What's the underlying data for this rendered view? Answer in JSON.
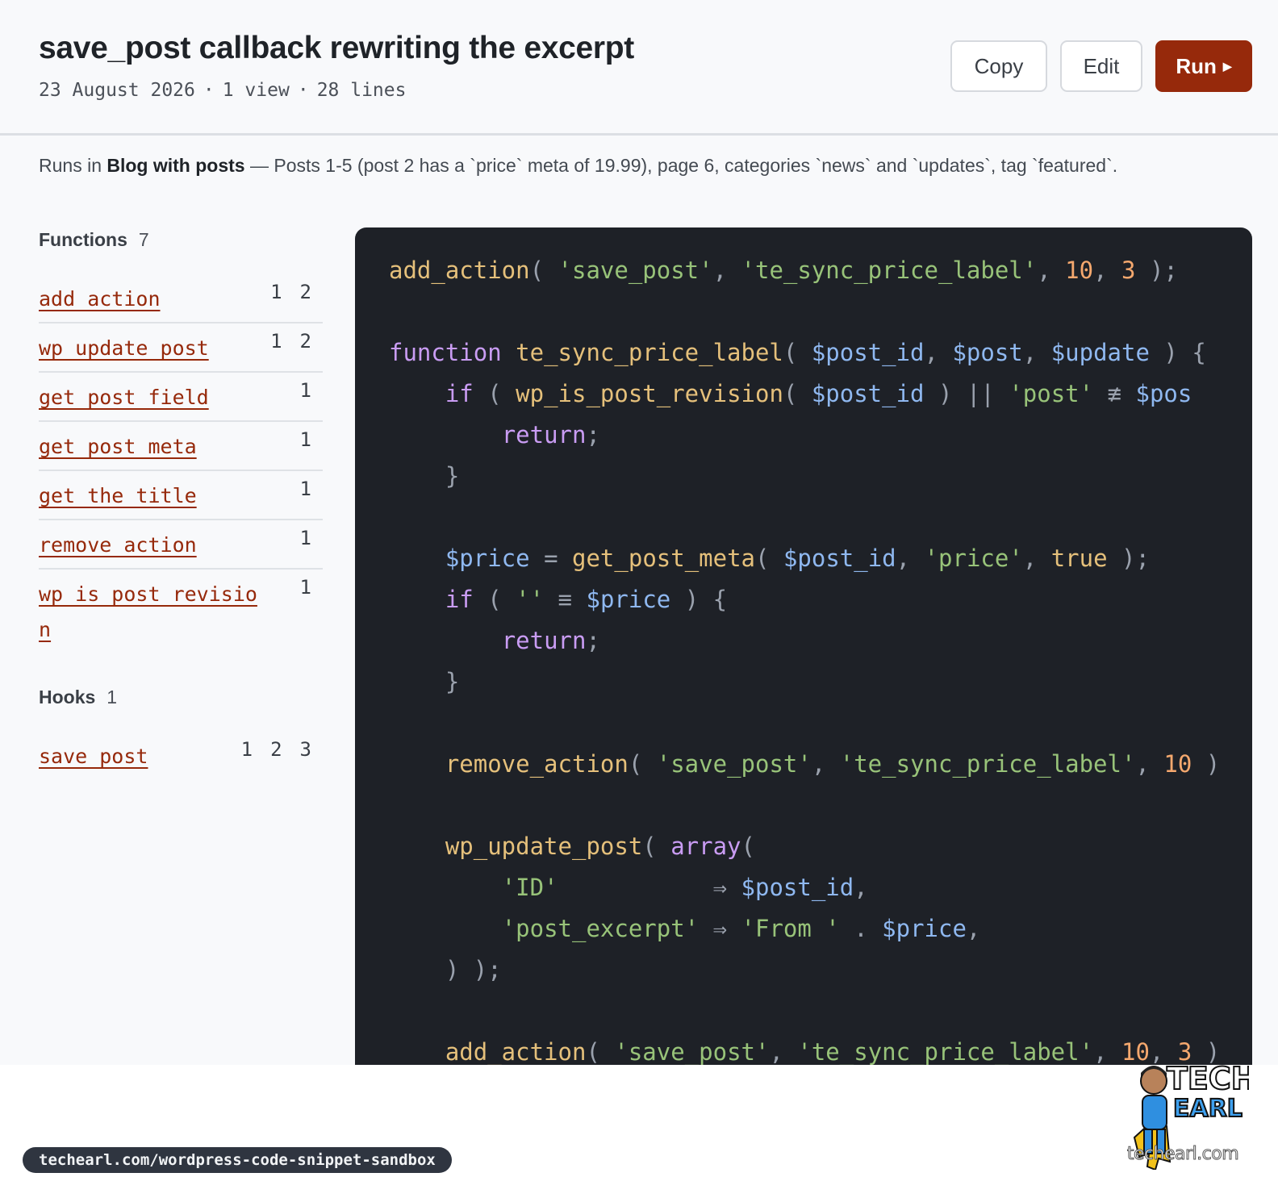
{
  "header": {
    "title": "save_post callback rewriting the excerpt",
    "date": "23 August 2026",
    "views": "1 view",
    "line_count": "28 lines",
    "separator": "·",
    "copy_label": "Copy",
    "edit_label": "Edit",
    "run_label": "Run",
    "run_icon": "play-triangle-icon"
  },
  "runs": {
    "prefix": "Runs in",
    "environment": "Blog with posts",
    "description": "— Posts 1-5 (post 2 has a `price` meta of 19.99), page 6, categories `news` and `updates`, tag `featured`."
  },
  "sidebar": {
    "functions_label": "Functions",
    "functions_count": "7",
    "functions": [
      {
        "name": "add_action",
        "lines": [
          "1",
          "2"
        ]
      },
      {
        "name": "wp_update_post",
        "lines": [
          "1",
          "2"
        ]
      },
      {
        "name": "get_post_field",
        "lines": [
          "1"
        ]
      },
      {
        "name": "get_post_meta",
        "lines": [
          "1"
        ]
      },
      {
        "name": "get_the_title",
        "lines": [
          "1"
        ]
      },
      {
        "name": "remove_action",
        "lines": [
          "1"
        ]
      },
      {
        "name": "wp_is_post_revision",
        "lines": [
          "1"
        ]
      }
    ],
    "hooks_label": "Hooks",
    "hooks_count": "1",
    "hooks": [
      {
        "name": "save_post",
        "lines": [
          "1",
          "2",
          "3"
        ]
      }
    ]
  },
  "code": {
    "lines": [
      "add_action( 'save_post', 'te_sync_price_label', 10, 3 );",
      "",
      "function te_sync_price_label( $post_id, $post, $update ) {",
      "    if ( wp_is_post_revision( $post_id ) || 'post' !== $pos",
      "        return;",
      "    }",
      "",
      "    $price = get_post_meta( $post_id, 'price', true );",
      "    if ( '' === $price ) {",
      "        return;",
      "    }",
      "",
      "    remove_action( 'save_post', 'te_sync_price_label', 10 )",
      "",
      "    wp_update_post( array(",
      "        'ID'           => $post_id,",
      "        'post_excerpt' => 'From ' . $price,",
      "    ) );",
      "",
      "    add_action( 'save_post', 'te_sync_price_label', 10, 3 )"
    ]
  },
  "footer": {
    "url": "techearl.com/wordpress-code-snippet-sandbox",
    "logo_text_top": "TECH",
    "logo_text_bottom": "EARL",
    "site": "techearl.com"
  },
  "colors": {
    "accent": "#96290b",
    "code_bg": "#1e2127",
    "string": "#98c379",
    "function": "#e5c07b",
    "keyword": "#c99cf3",
    "variable": "#8fb8f0",
    "number": "#f5a86e"
  }
}
